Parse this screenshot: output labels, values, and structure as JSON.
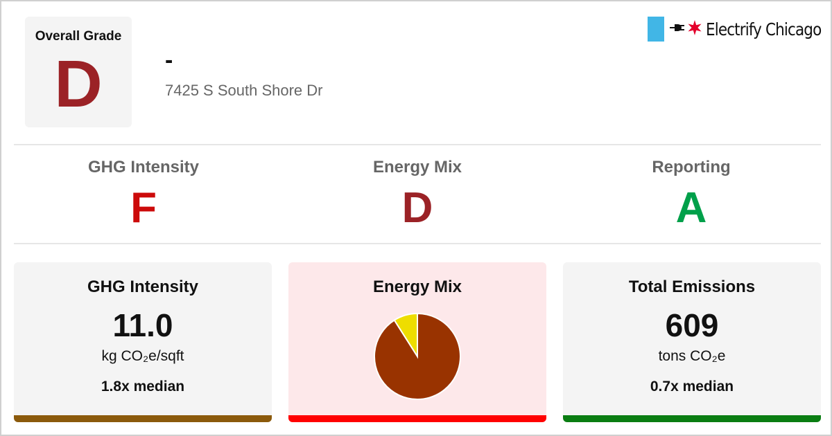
{
  "overall": {
    "label": "Overall Grade",
    "grade": "D",
    "color": "#9b2226"
  },
  "building": {
    "name": "-",
    "address": "7425 S South Shore Dr"
  },
  "logo": {
    "text": "Electrify Chicago",
    "bar_color": "#41b6e6",
    "star_color": "#e4002b"
  },
  "sub_grades": [
    {
      "label": "GHG Intensity",
      "grade": "F",
      "color": "#cc0a0a"
    },
    {
      "label": "Energy Mix",
      "grade": "D",
      "color": "#9b2226"
    },
    {
      "label": "Reporting",
      "grade": "A",
      "color": "#00a04a"
    }
  ],
  "cards": {
    "ghg": {
      "title": "GHG Intensity",
      "value": "11.0",
      "unit": "kg CO₂e/sqft",
      "median": "1.8x median",
      "bar_color": "#8b5a0c"
    },
    "mix": {
      "title": "Energy Mix",
      "bar_color": "#ff0000"
    },
    "total": {
      "title": "Total Emissions",
      "value": "609",
      "unit": "tons CO₂e",
      "median": "0.7x median",
      "bar_color": "#0a7d12"
    }
  },
  "chart_data": {
    "type": "pie",
    "slices": [
      {
        "value": 91,
        "color": "#993300"
      },
      {
        "value": 9,
        "color": "#eedd00"
      }
    ]
  }
}
